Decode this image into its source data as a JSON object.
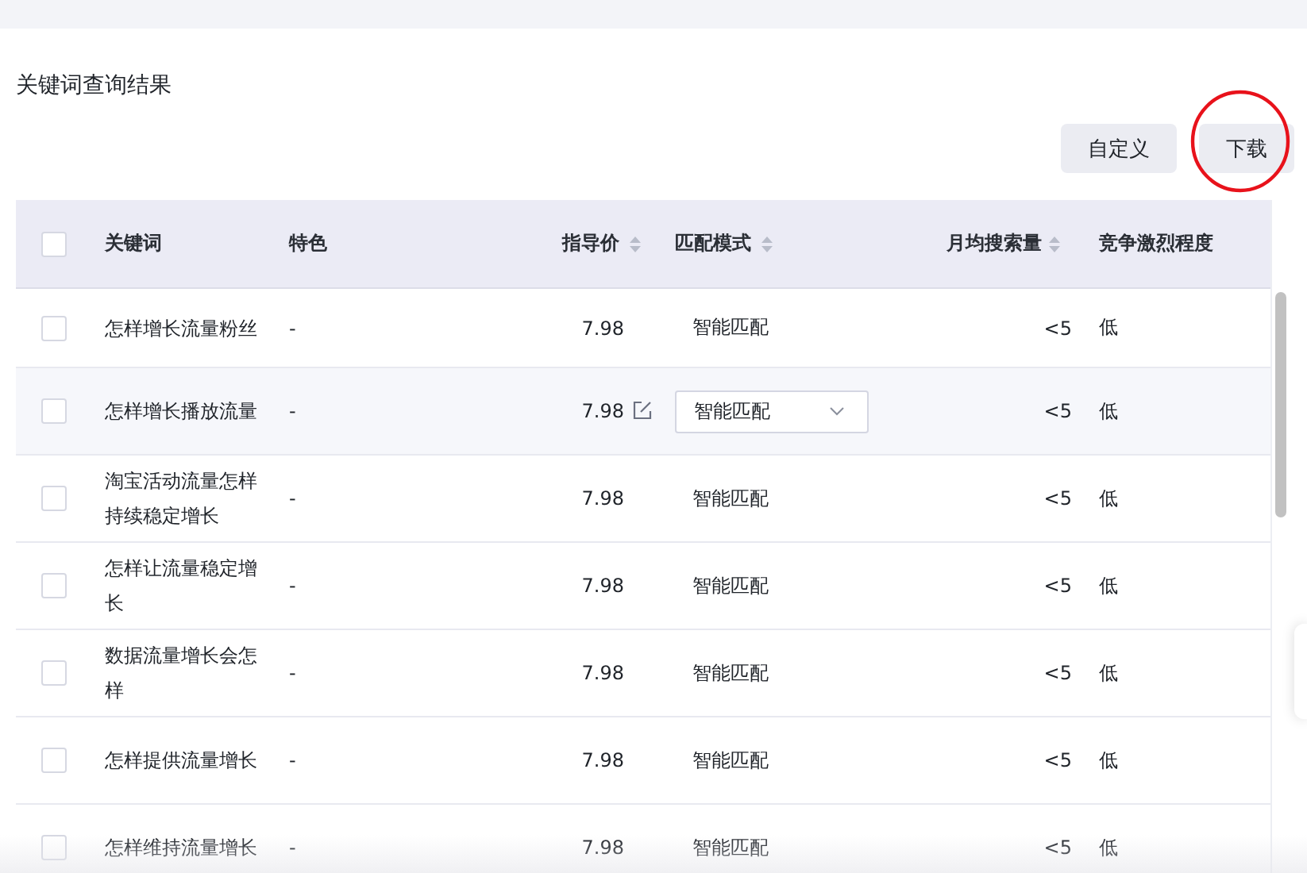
{
  "title": "关键词查询结果",
  "buttons": [
    {
      "label": "自定义",
      "circled": false
    },
    {
      "label": "下载",
      "circled": true
    }
  ],
  "table": {
    "header_checked": false,
    "columns": [
      {
        "label": "关键词",
        "sortable": false
      },
      {
        "label": "特色",
        "sortable": false
      },
      {
        "label": "指导价",
        "sortable": true
      },
      {
        "label": "匹配模式",
        "sortable": true
      },
      {
        "label": "月均搜索量",
        "sortable": true
      },
      {
        "label": "竞争激烈程度",
        "sortable": false
      }
    ],
    "rows": [
      {
        "checked": false,
        "hovered": false,
        "keyword": "怎样增长流量粉丝",
        "feature": "-",
        "price": "7.98",
        "match": "智能匹配",
        "monthly": "<5",
        "competition": "低"
      },
      {
        "checked": false,
        "hovered": true,
        "keyword": "怎样增长播放流量",
        "feature": "-",
        "price": "7.98",
        "match": "智能匹配",
        "monthly": "<5",
        "competition": "低"
      },
      {
        "checked": false,
        "hovered": false,
        "keyword": "淘宝活动流量怎样持续稳定增长",
        "feature": "-",
        "price": "7.98",
        "match": "智能匹配",
        "monthly": "<5",
        "competition": "低"
      },
      {
        "checked": false,
        "hovered": false,
        "keyword": "怎样让流量稳定增长",
        "feature": "-",
        "price": "7.98",
        "match": "智能匹配",
        "monthly": "<5",
        "competition": "低"
      },
      {
        "checked": false,
        "hovered": false,
        "keyword": "数据流量增长会怎样",
        "feature": "-",
        "price": "7.98",
        "match": "智能匹配",
        "monthly": "<5",
        "competition": "低"
      },
      {
        "checked": false,
        "hovered": false,
        "keyword": "怎样提供流量增长",
        "feature": "-",
        "price": "7.98",
        "match": "智能匹配",
        "monthly": "<5",
        "competition": "低"
      },
      {
        "checked": false,
        "hovered": false,
        "keyword": "怎样维持流量增长",
        "feature": "-",
        "price": "7.98",
        "match": "智能匹配",
        "monthly": "<5",
        "competition": "低"
      }
    ]
  }
}
